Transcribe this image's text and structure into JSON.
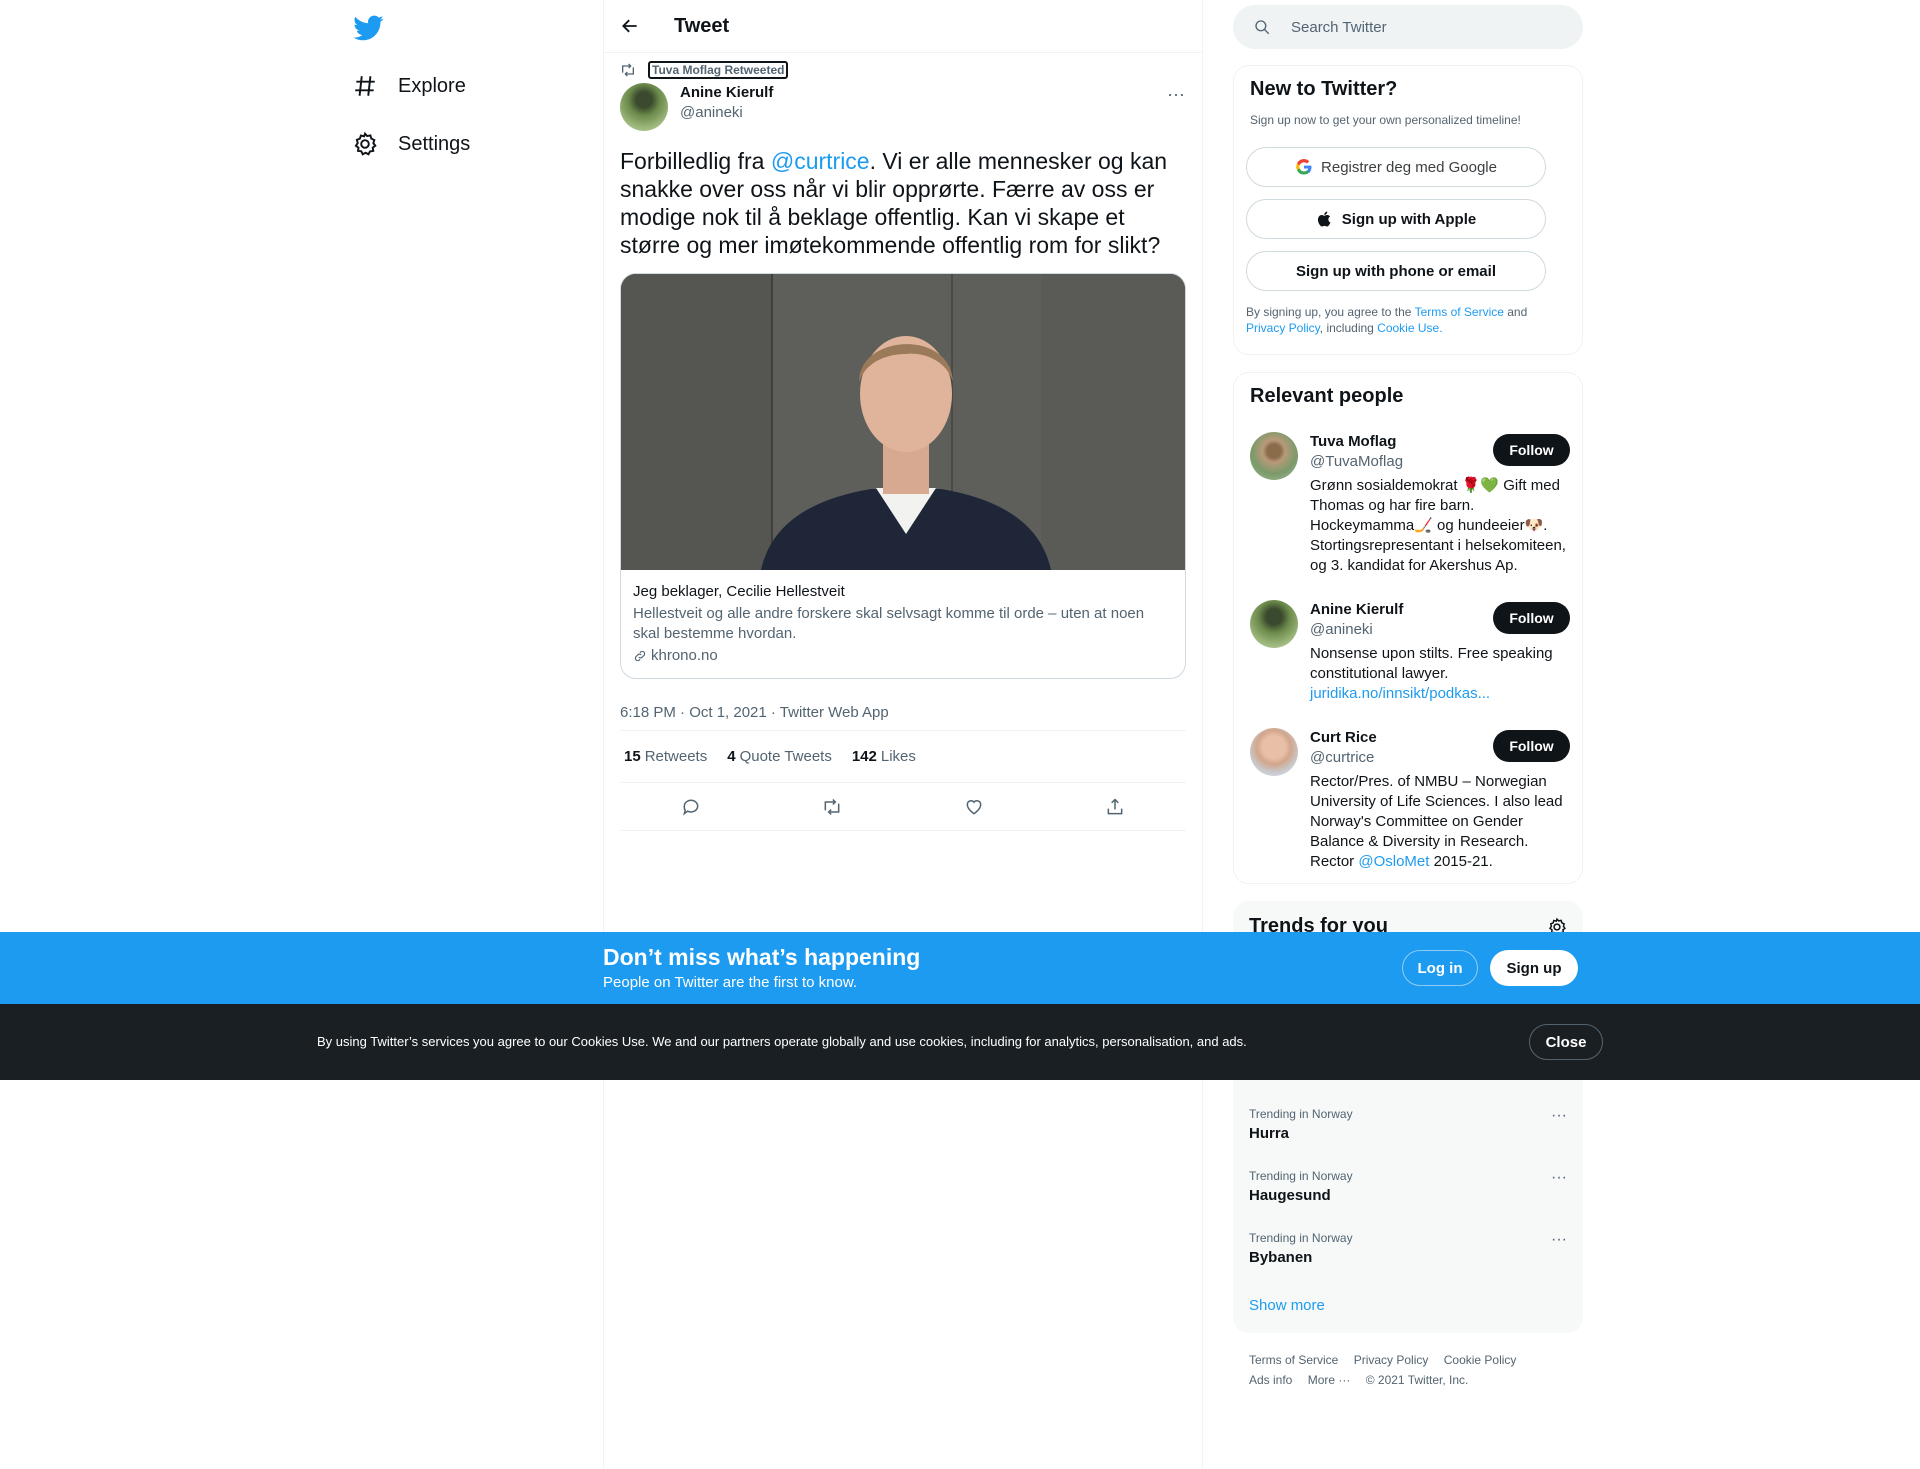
{
  "nav": {
    "explore_label": "Explore",
    "settings_label": "Settings"
  },
  "header": {
    "title": "Tweet"
  },
  "tweet": {
    "retweeted_by": "Tuva Moflag Retweeted",
    "author_name": "Anine Kierulf",
    "author_handle": "@anineki",
    "text_before": "Forbilledlig fra ",
    "mention": "@curtrice",
    "text_after": ". Vi er alle mennesker og kan snakke over oss når vi blir opprørte. Færre av oss er modige nok til å beklage offentlig. Kan vi skape et større og mer imøtekommende offentlig rom for slikt?",
    "card": {
      "title": "Jeg beklager, Cecilie Hellestveit",
      "description": "Hellestveit og alle andre forskere skal selvsagt komme til orde – uten at noen skal bestemme hvordan.",
      "domain": "khrono.no"
    },
    "timestamp": "6:18 PM · Oct 1, 2021 · Twitter Web App",
    "stats": {
      "retweets_count": "15",
      "retweets_label": "Retweets",
      "quotes_count": "4",
      "quotes_label": "Quote Tweets",
      "likes_count": "142",
      "likes_label": "Likes"
    }
  },
  "search": {
    "placeholder": "Search Twitter"
  },
  "new_to_twitter": {
    "title": "New to Twitter?",
    "subtitle": "Sign up now to get your own personalized timeline!",
    "google_label": "Registrer deg med Google",
    "apple_label": "Sign up with Apple",
    "phone_label": "Sign up with phone or email",
    "terms_1": "By signing up, you agree to the ",
    "terms_link": "Terms of Service",
    "terms_2": " and ",
    "privacy_link": "Privacy Policy",
    "terms_3": ", including ",
    "cookie_link": "Cookie Use."
  },
  "relevant_people": {
    "title": "Relevant people",
    "follow_label": "Follow",
    "people": [
      {
        "name": "Tuva Moflag",
        "handle": "@TuvaMoflag",
        "bio": "Grønn sosialdemokrat 🌹💚 Gift med Thomas og har fire barn. Hockeymamma🏒 og hundeeier🐶. Stortingsrepresentant i helsekomiteen, og 3. kandidat for Akershus Ap."
      },
      {
        "name": "Anine Kierulf",
        "handle": "@anineki",
        "bio": "Nonsense upon stilts. Free speaking constitutional lawyer.",
        "link": "juridika.no/innsikt/podkas..."
      },
      {
        "name": "Curt Rice",
        "handle": "@curtrice",
        "bio_1": "Rector/Pres. of NMBU – Norwegian University of Life Sciences. I also lead Norway's Committee on Gender Balance & Diversity in Research. Rector ",
        "bio_mention": "@OsloMet",
        "bio_2": " 2015-21."
      }
    ]
  },
  "trends": {
    "title": "Trends for you",
    "items": [
      {
        "meta": "Trending in Norway",
        "name": "Hurra"
      },
      {
        "meta": "Trending in Norway",
        "name": "Haugesund"
      },
      {
        "meta": "Trending in Norway",
        "name": "Bybanen"
      }
    ],
    "show_more": "Show more"
  },
  "footer": {
    "terms": "Terms of Service",
    "privacy": "Privacy Policy",
    "cookie": "Cookie Policy",
    "ads": "Ads info",
    "more": "More ···",
    "copyright": "© 2021 Twitter, Inc."
  },
  "bottom_banner": {
    "title": "Don’t miss what’s happening",
    "subtitle": "People on Twitter are the first to know.",
    "login_label": "Log in",
    "signup_label": "Sign up"
  },
  "cookie_banner": {
    "text": "By using Twitter’s services you agree to our Cookies Use. We and our partners operate globally and use cookies, including for analytics, personalisation, and ads.",
    "close_label": "Close"
  },
  "colors": {
    "accent": "#1d9bf0",
    "dark": "#0f1419",
    "muted": "#536471"
  }
}
